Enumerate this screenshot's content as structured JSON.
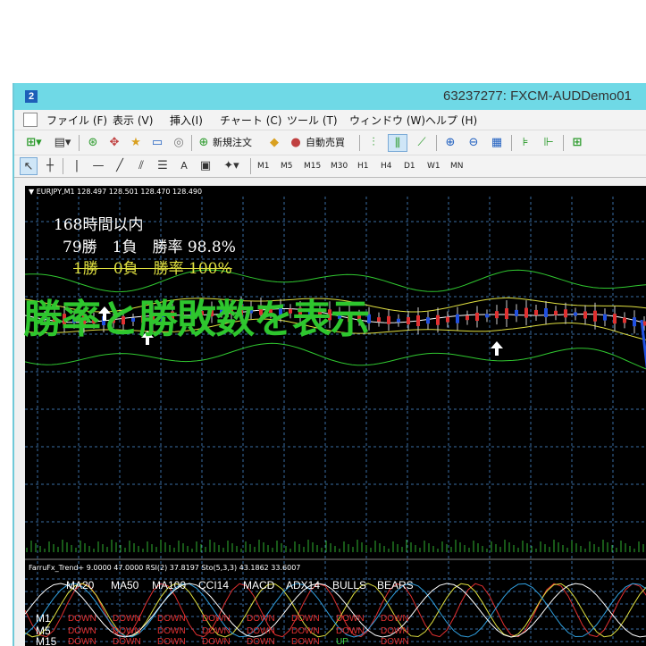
{
  "window": {
    "title": "63237277: FXCM-AUDDemo01"
  },
  "menu": {
    "items": [
      "ファイル (F)",
      "表示 (V)",
      "挿入(I)",
      "チャート (C)",
      "ツール (T)",
      "ウィンドウ (W)",
      "ヘルプ (H)"
    ]
  },
  "toolbar": {
    "new_order": "新規注文",
    "auto_trade": "自動売買",
    "text_tool": "A"
  },
  "timeframes": [
    "M1",
    "M5",
    "M15",
    "M30",
    "H1",
    "H4",
    "D1",
    "W1",
    "MN"
  ],
  "chart": {
    "symbol_info": "▼ EURJPY,M1  128.497 128.501 128.470 128.490",
    "stats": {
      "period": "168時間以内",
      "line1": "79勝　1負　勝率 98.8%",
      "line2": "1勝　0負　勝率 100%"
    },
    "overlay_caption": "勝率と勝敗数を表示",
    "colors": {
      "background": "#000000",
      "grid": "#3a6ea5",
      "bullish": "#e03030",
      "bearish": "#2050e0",
      "band_outer": "#30c830",
      "band_inner": "#e0e040",
      "stats_primary": "#ffffff",
      "stats_secondary": "#e0e040",
      "caption": "#2ec62e"
    }
  },
  "indicator_panel": {
    "header": "FarruFx_Trend+ 9.0000 47.0000  RSI(2) 37.8197  Sto(5,3,3) 43.1862 33.6007",
    "columns": [
      "MA20",
      "MA50",
      "MA100",
      "CCI14",
      "MACD",
      "ADX14",
      "BULLS",
      "BEARS"
    ],
    "rows": [
      {
        "tf": "M1",
        "signals": [
          "DOWN",
          "DOWN",
          "DOWN",
          "DOWN",
          "DOWN",
          "DOWN",
          "DOWN",
          "DOWN"
        ]
      },
      {
        "tf": "M5",
        "signals": [
          "DOWN",
          "DOWN",
          "DOWN",
          "DOWN",
          "DOWN",
          "DOWN",
          "DOWN",
          "DOWN"
        ]
      },
      {
        "tf": "M15",
        "signals": [
          "DOWN",
          "DOWN",
          "DOWN",
          "DOWN",
          "DOWN",
          "DOWN",
          "UP",
          "DOWN"
        ]
      }
    ]
  }
}
